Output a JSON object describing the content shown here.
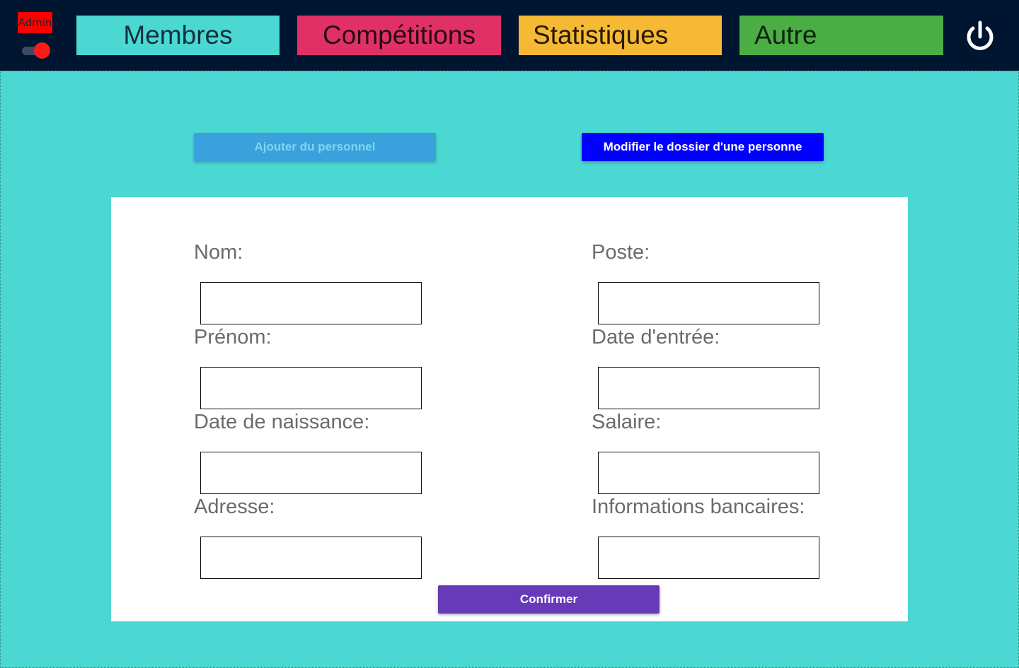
{
  "header": {
    "admin_label": "Admin",
    "admin_toggle_on": true,
    "nav": [
      {
        "label": "Membres",
        "color": "#4bd8d2"
      },
      {
        "label": "Compétitions",
        "color": "#e03166"
      },
      {
        "label": "Statistiques",
        "color": "#f5b935"
      },
      {
        "label": "Autre",
        "color": "#4aae44"
      }
    ],
    "power_icon": "power-icon"
  },
  "actions": {
    "add_label": "Ajouter du personnel",
    "edit_label": "Modifier le dossier d'une personne"
  },
  "form": {
    "left": [
      {
        "label": "Nom:",
        "value": ""
      },
      {
        "label": "Prénom:",
        "value": ""
      },
      {
        "label": "Date de naissance:",
        "value": ""
      },
      {
        "label": "Adresse:",
        "value": ""
      }
    ],
    "right": [
      {
        "label": "Poste:",
        "value": ""
      },
      {
        "label": "Date d'entrée:",
        "value": ""
      },
      {
        "label": "Salaire:",
        "value": ""
      },
      {
        "label": "Informations bancaires:",
        "value": ""
      }
    ],
    "confirm_label": "Confirmer"
  },
  "colors": {
    "background": "#4bd8d2",
    "topbar": "#001530",
    "admin_badge": "#ff0000",
    "add_button": "#3aa1dc",
    "edit_button": "#0000ff",
    "confirm_button": "#673ab7"
  }
}
